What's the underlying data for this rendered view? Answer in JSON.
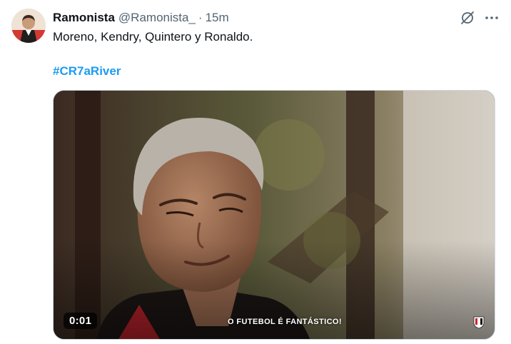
{
  "tweet": {
    "display_name": "Ramonista",
    "handle": "@Ramonista_",
    "separator": "·",
    "timestamp": "15m",
    "text": "Moreno, Kendry, Quintero y Ronaldo.",
    "hashtag": "#CR7aRiver"
  },
  "actions": {
    "grok_icon": "grok-icon",
    "more_icon": "more-icon"
  },
  "media": {
    "type": "video",
    "timecode": "0:01",
    "caption": "O FUTEBOL É FANTÁSTICO!",
    "logo_icon": "club-crest-icon"
  },
  "colors": {
    "accent": "#1d9bf0",
    "text": "#0f1419",
    "secondary": "#536471"
  }
}
